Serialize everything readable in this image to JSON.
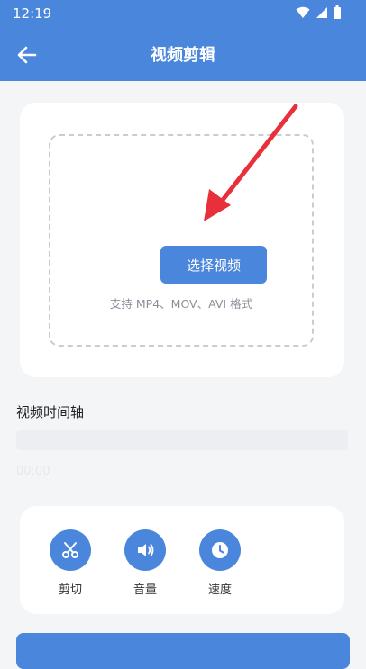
{
  "status_bar": {
    "time": "12:19",
    "icons": [
      "wifi-icon",
      "signal-icon",
      "battery-icon"
    ]
  },
  "app_bar": {
    "title": "视频剪辑",
    "back_icon": "arrow-left-icon"
  },
  "upload": {
    "button_label": "选择视频",
    "hint": "支持 MP4、MOV、AVI 格式"
  },
  "timeline": {
    "label": "视频时间轴",
    "time": "00:00"
  },
  "tools": [
    {
      "label": "剪切",
      "icon": "scissors-icon"
    },
    {
      "label": "音量",
      "icon": "volume-icon"
    },
    {
      "label": "速度",
      "icon": "clock-icon"
    }
  ],
  "colors": {
    "primary": "#4a86dc",
    "background": "#f4f5f7",
    "annotation_arrow": "#e8303a"
  }
}
